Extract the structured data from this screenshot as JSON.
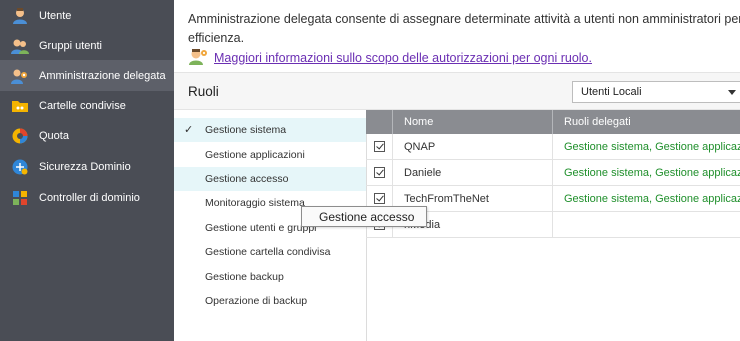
{
  "sidebar": {
    "items": [
      {
        "label": "Utente",
        "icon": "user-icon"
      },
      {
        "label": "Gruppi utenti",
        "icon": "user-group-icon"
      },
      {
        "label": "Amministrazione delegata",
        "icon": "delegated-admin-icon",
        "active": true
      },
      {
        "label": "Cartelle condivise",
        "icon": "shared-folder-icon"
      },
      {
        "label": "Quota",
        "icon": "quota-icon"
      },
      {
        "label": "Sicurezza Dominio",
        "icon": "domain-security-icon"
      },
      {
        "label": "Controller di dominio",
        "icon": "domain-controller-icon"
      }
    ]
  },
  "main": {
    "intro_line1": "Amministrazione delegata consente di assegnare determinate attività a utenti non amministratori per c",
    "intro_line2": "efficienza.",
    "info_link": "Maggiori informazioni sullo scopo delle autorizzazioni per ogni ruolo.",
    "roles_title": "Ruoli",
    "user_source": "Utenti Locali"
  },
  "roles": [
    {
      "label": "Gestione sistema",
      "checked": true,
      "highlight": true
    },
    {
      "label": "Gestione applicazioni"
    },
    {
      "label": "Gestione accesso",
      "highlight": true
    },
    {
      "label": "Monitoraggio sistema"
    },
    {
      "label": "Gestione utenti e gruppi"
    },
    {
      "label": "Gestione cartella condivisa"
    },
    {
      "label": "Gestione backup"
    },
    {
      "label": "Operazione di backup"
    }
  ],
  "table": {
    "headers": {
      "name": "Nome",
      "roles": "Ruoli delegati"
    },
    "rows": [
      {
        "name": "QNAP",
        "roles": "Gestione sistema, Gestione applicazioni, G"
      },
      {
        "name": "Daniele",
        "roles": "Gestione sistema, Gestione applicazioni, G"
      },
      {
        "name": "TechFromTheNet",
        "roles": "Gestione sistema, Gestione applicazioni, G"
      },
      {
        "name": "nMedia",
        "roles": ""
      }
    ]
  },
  "tooltip": "Gestione accesso",
  "colors": {
    "sidebar": "#4a4d55",
    "active": "#5d6069",
    "link": "#6b2fb3",
    "role_text": "#1f8f2b",
    "header": "#8a8c91"
  }
}
